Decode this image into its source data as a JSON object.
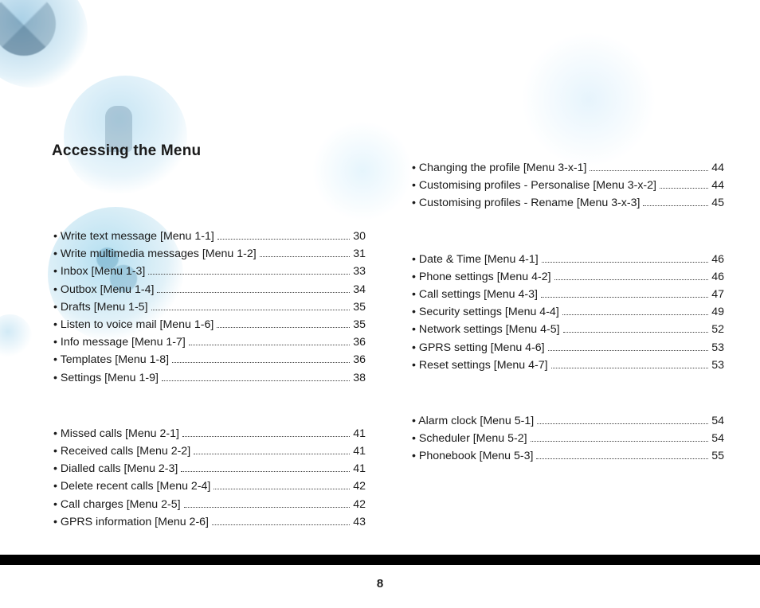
{
  "heading": "Accessing the Menu",
  "page_number": "8",
  "columns": {
    "left": [
      {
        "entries": [
          {
            "label": "• Write text message [Menu 1-1]",
            "page": "30"
          },
          {
            "label": "• Write multimedia messages [Menu 1-2]",
            "page": "31"
          },
          {
            "label": "• Inbox [Menu 1-3]",
            "page": "33"
          },
          {
            "label": "• Outbox [Menu 1-4]",
            "page": "34"
          },
          {
            "label": "• Drafts [Menu 1-5]",
            "page": "35"
          },
          {
            "label": "• Listen to voice mail [Menu 1-6]",
            "page": "35"
          },
          {
            "label": "• Info message [Menu 1-7]",
            "page": "36"
          },
          {
            "label": "• Templates [Menu 1-8]",
            "page": "36"
          },
          {
            "label": "• Settings [Menu 1-9]",
            "page": "38"
          }
        ]
      },
      {
        "entries": [
          {
            "label": "• Missed calls [Menu 2-1]",
            "page": "41"
          },
          {
            "label": "• Received calls [Menu 2-2]",
            "page": "41"
          },
          {
            "label": "• Dialled calls [Menu 2-3]",
            "page": "41"
          },
          {
            "label": "• Delete recent calls [Menu 2-4]",
            "page": "42"
          },
          {
            "label": "• Call charges [Menu 2-5]",
            "page": "42"
          },
          {
            "label": "• GPRS information [Menu 2-6]",
            "page": "43"
          }
        ]
      }
    ],
    "right": [
      {
        "entries": [
          {
            "label": "• Changing the profile [Menu 3-x-1]",
            "page": "44"
          },
          {
            "label": "• Customising profiles - Personalise [Menu 3-x-2]",
            "page": "44"
          },
          {
            "label": "• Customising profiles - Rename [Menu 3-x-3]",
            "page": "45"
          }
        ]
      },
      {
        "entries": [
          {
            "label": "• Date & Time [Menu 4-1]",
            "page": "46"
          },
          {
            "label": "• Phone settings [Menu 4-2]",
            "page": "46"
          },
          {
            "label": "• Call settings [Menu 4-3]",
            "page": "47"
          },
          {
            "label": "• Security settings [Menu 4-4]",
            "page": "49"
          },
          {
            "label": "• Network settings [Menu 4-5]",
            "page": "52"
          },
          {
            "label": "• GPRS setting [Menu 4-6]",
            "page": "53"
          },
          {
            "label": "• Reset settings [Menu 4-7]",
            "page": "53"
          }
        ]
      },
      {
        "entries": [
          {
            "label": "• Alarm clock [Menu 5-1]",
            "page": "54"
          },
          {
            "label": "• Scheduler [Menu 5-2]",
            "page": "54"
          },
          {
            "label": "• Phonebook [Menu 5-3]",
            "page": "55"
          }
        ]
      }
    ]
  }
}
